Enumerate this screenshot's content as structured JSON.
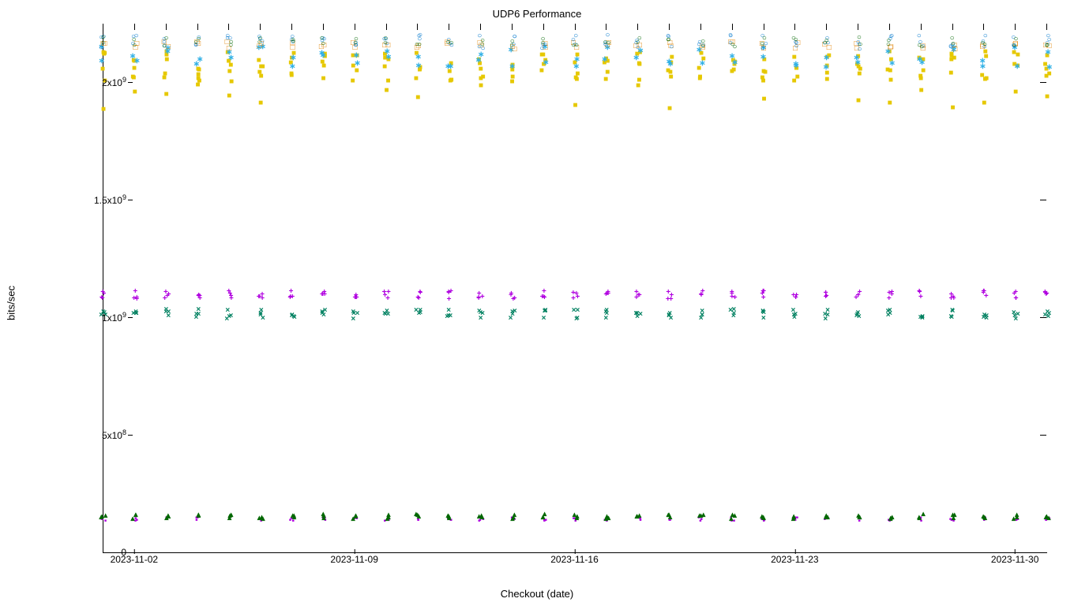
{
  "chart_data": {
    "type": "scatter",
    "title": "UDP6 Performance",
    "xlabel": "Checkout (date)",
    "ylabel": "bits/sec",
    "ylim": [
      0,
      2250000000
    ],
    "y_ticks": [
      {
        "value": 0,
        "label": "0"
      },
      {
        "value": 500000000,
        "label": "5x10",
        "exp": "8"
      },
      {
        "value": 1000000000,
        "label": "1x10",
        "exp": "9"
      },
      {
        "value": 1500000000,
        "label": "1.5x10",
        "exp": "9"
      },
      {
        "value": 2000000000,
        "label": "2x10",
        "exp": "9"
      }
    ],
    "x_range_days": [
      0,
      30
    ],
    "x_major_ticks": [
      {
        "day": 1,
        "label": "2023-11-02"
      },
      {
        "day": 8,
        "label": "2023-11-09"
      },
      {
        "day": 15,
        "label": "2023-11-16"
      },
      {
        "day": 22,
        "label": "2023-11-23"
      },
      {
        "day": 29,
        "label": "2023-11-30"
      }
    ],
    "dates_all_days": [
      0,
      1,
      2,
      3,
      4,
      5,
      6,
      7,
      8,
      9,
      10,
      11,
      12,
      13,
      14,
      15,
      16,
      17,
      18,
      19,
      20,
      21,
      22,
      23,
      24,
      25,
      26,
      27,
      28,
      29,
      30
    ],
    "series": [
      {
        "name": "band-low-fill-magenta",
        "marker": "▪",
        "class": "s-plus",
        "band": [
          130000000,
          145000000
        ],
        "count": 3
      },
      {
        "name": "band-low-fill-dgreen",
        "marker": "▴",
        "class": "s-dgreen",
        "band": [
          140000000,
          160000000
        ],
        "count": 3
      },
      {
        "name": "band-mid-teal-cross",
        "marker": "×",
        "class": "s-cross",
        "band": [
          990000000,
          1030000000
        ],
        "count": 4
      },
      {
        "name": "band-mid-magenta-plus",
        "marker": "+",
        "class": "s-plus",
        "band": [
          1075000000,
          1110000000
        ],
        "count": 4
      },
      {
        "name": "band-high-yellow-square",
        "marker": "■",
        "class": "s-square",
        "band": [
          2000000000,
          2130000000
        ],
        "count": 5
      },
      {
        "name": "band-high-cyan-star",
        "marker": "∗",
        "class": "s-star",
        "band": [
          2060000000,
          2150000000
        ],
        "count": 2
      },
      {
        "name": "band-high-orange-open-sq",
        "marker": "□",
        "class": "s-sqo",
        "band": [
          2140000000,
          2170000000
        ],
        "count": 2
      },
      {
        "name": "band-high-blue-circle",
        "marker": "○",
        "class": "s-circle",
        "band": [
          2140000000,
          2200000000
        ],
        "count": 3
      },
      {
        "name": "band-high-green-circle",
        "marker": "○",
        "class": "s-dgreen",
        "band": [
          2150000000,
          2190000000
        ],
        "count": 2
      }
    ],
    "low_outliers_yellow": {
      "days": [
        0,
        1,
        2,
        3,
        4,
        5,
        9,
        10,
        12,
        15,
        17,
        18,
        21,
        24,
        25,
        26,
        27,
        28,
        29,
        30
      ],
      "value_band": [
        1880000000,
        1990000000
      ]
    }
  }
}
